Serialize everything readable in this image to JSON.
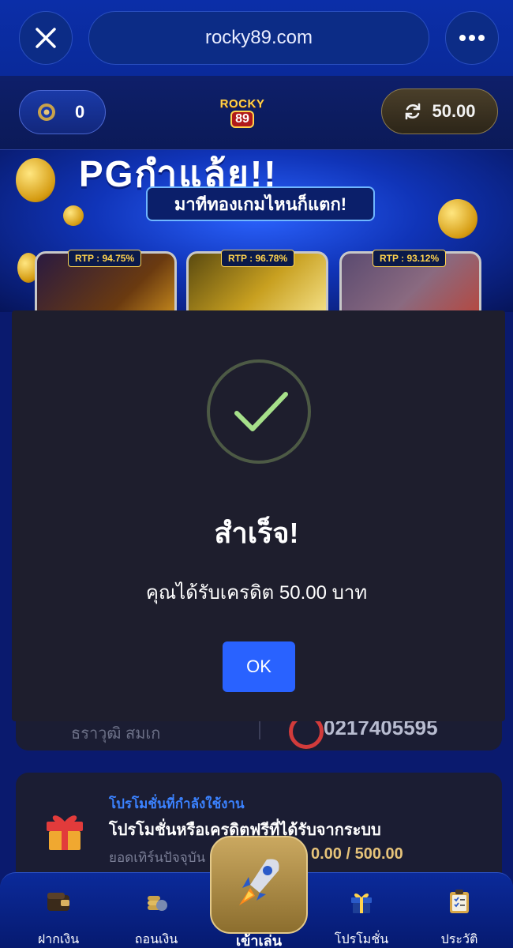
{
  "browser": {
    "url": "rocky89.com"
  },
  "header": {
    "coin_value": "0",
    "logo_top": "ROCKY",
    "logo_bottom": "89",
    "balance": "50.00"
  },
  "banner": {
    "headline": "PGกำแล้ย!!",
    "subtitle": "มาทีทองเกมไหนก็แตก!",
    "games": [
      {
        "rtp": "RTP : 94.75%"
      },
      {
        "rtp": "RTP : 96.78%"
      },
      {
        "rtp": "RTP : 93.12%"
      }
    ]
  },
  "background": {
    "info_partial_left": "ธราวุฒิ สมเก",
    "info_partial_right": "0217405595",
    "promo": {
      "label": "โปรโมชั่นที่กำลังใช้งาน",
      "title": "โปรโมชั่นหรือเครดิตฟรีที่ได้รับจากระบบ",
      "sub": "ยอดเทิร์นปัจจุบัน",
      "amount": "0.00 / 500.00"
    }
  },
  "modal": {
    "title": "สำเร็จ!",
    "message": "คุณได้รับเครดิต 50.00 บาท",
    "ok_label": "OK",
    "check_color": "#a6e08a"
  },
  "nav": {
    "deposit": "ฝากเงิน",
    "withdraw": "ถอนเงิน",
    "play": "เข้าเล่น",
    "promotion": "โปรโมชั่น",
    "history": "ประวัติ"
  }
}
